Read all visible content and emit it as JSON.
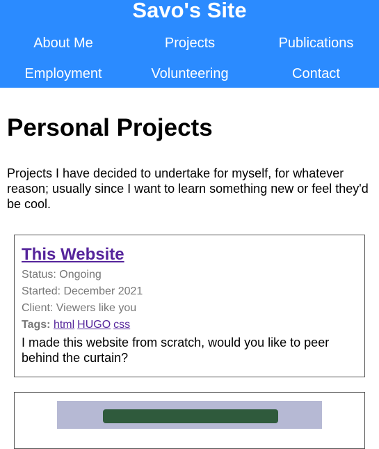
{
  "site": {
    "title": "Savo's Site"
  },
  "nav": [
    {
      "label": "About Me"
    },
    {
      "label": "Projects"
    },
    {
      "label": "Publications"
    },
    {
      "label": "Employment"
    },
    {
      "label": "Volunteering"
    },
    {
      "label": "Contact"
    }
  ],
  "page": {
    "title": "Personal Projects",
    "intro": "Projects I have decided to undertake for myself, for whatever reason; usually since I want to learn something new or feel they'd be cool."
  },
  "projects": [
    {
      "title": "This Website",
      "status": "Status: Ongoing",
      "started": "Started: December 2021",
      "client": "Client: Viewers like you",
      "tags_label": "Tags:",
      "tags": [
        "html",
        "HUGO",
        "css"
      ],
      "description": "I made this website from scratch, would you like to peer behind the curtain?"
    }
  ],
  "colors": {
    "header": "#2b8bff",
    "link": "#55249b",
    "meta": "#777777"
  }
}
